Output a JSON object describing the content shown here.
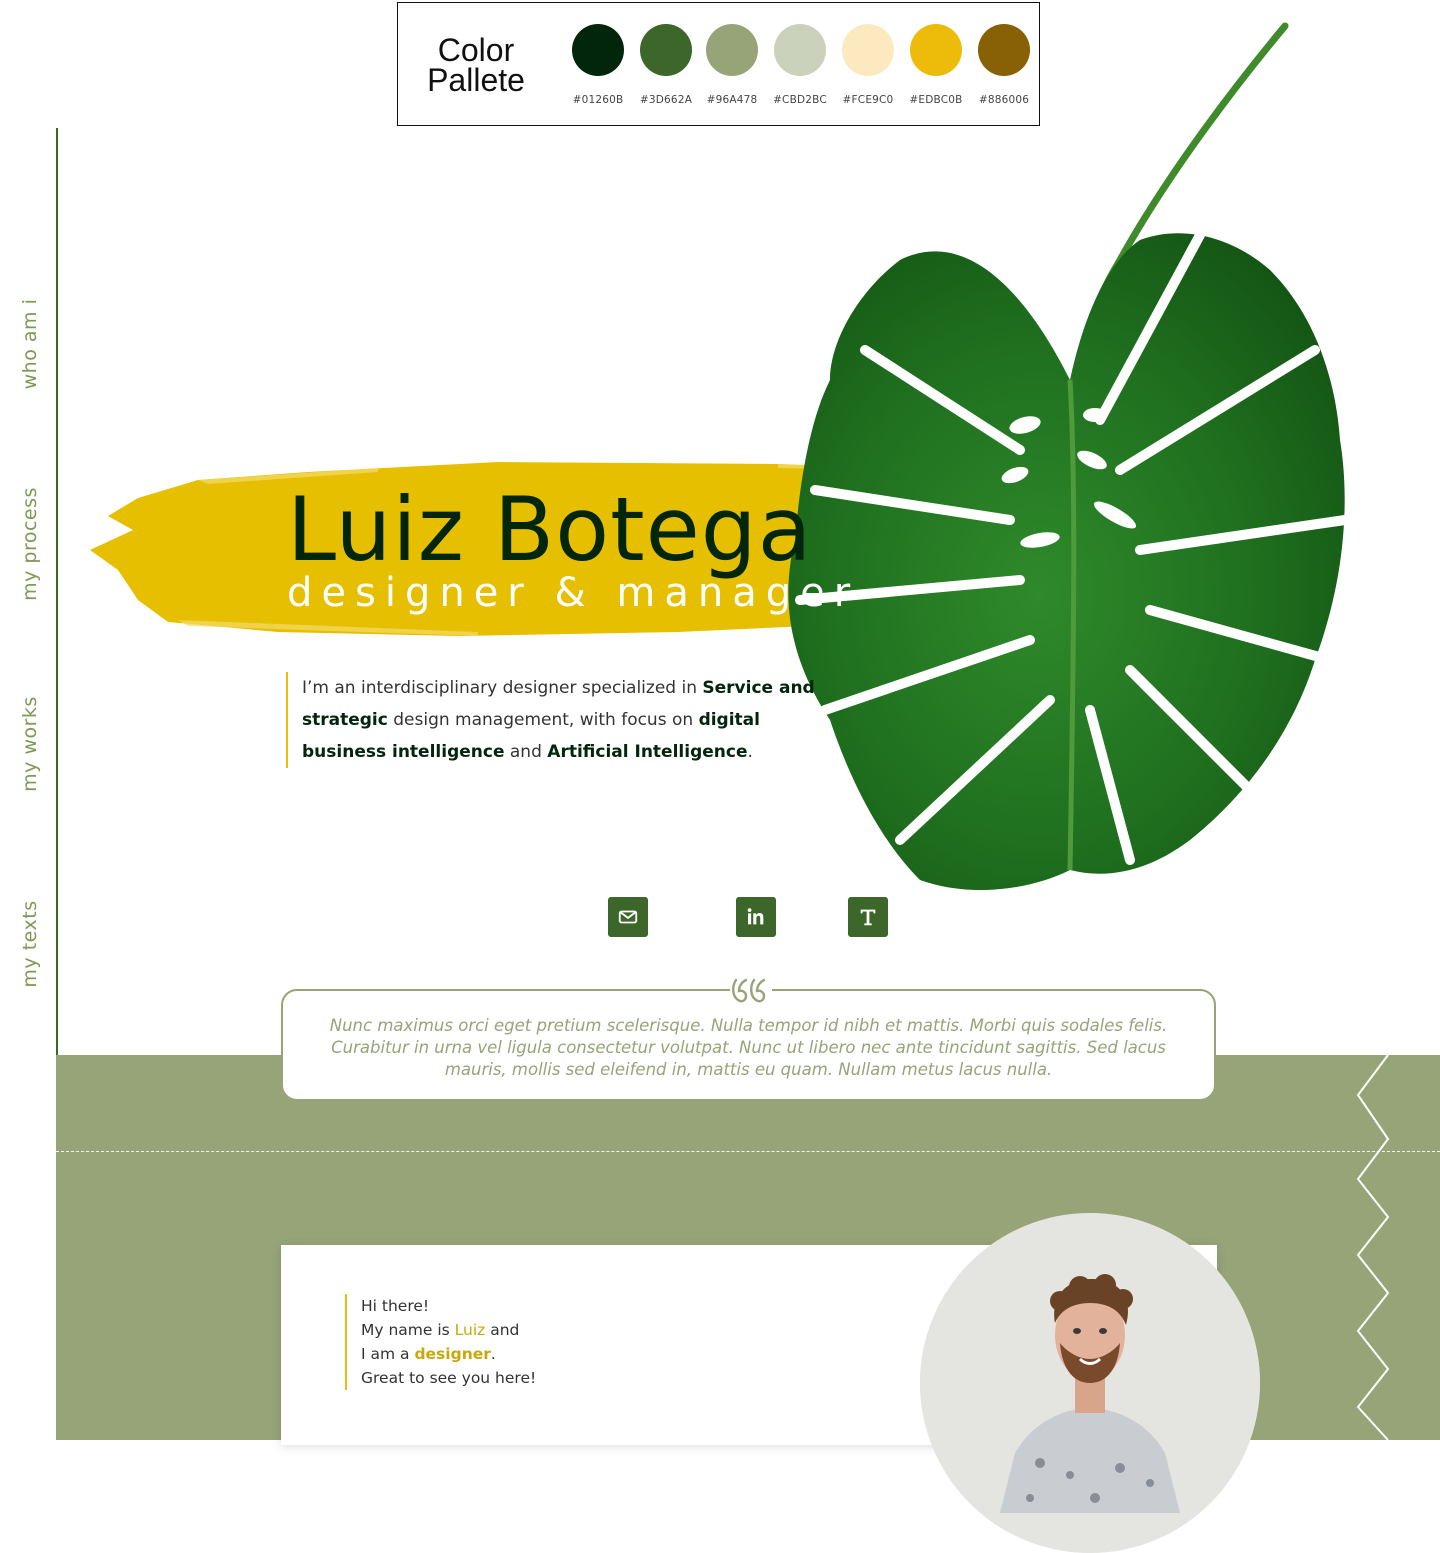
{
  "palette": {
    "title_line1": "Color",
    "title_line2": "Pallete",
    "swatches": [
      {
        "hex": "#01260B",
        "label": "#01260B"
      },
      {
        "hex": "#3D662A",
        "label": "#3D662A"
      },
      {
        "hex": "#96A478",
        "label": "#96A478"
      },
      {
        "hex": "#CBD2BC",
        "label": "#CBD2BC"
      },
      {
        "hex": "#FCE9C0",
        "label": "#FCE9C0"
      },
      {
        "hex": "#EDBC0B",
        "label": "#EDBC0B"
      },
      {
        "hex": "#886006",
        "label": "#886006"
      }
    ]
  },
  "nav": {
    "who_am_i": "who am i",
    "my_process": "my process",
    "my_works": "my works",
    "my_texts": "my texts"
  },
  "hero": {
    "name": "Luiz Botega",
    "role": "designer & manager"
  },
  "intro": {
    "t1": "I’m an interdisciplinary designer specialized in ",
    "b1": "Service and strategic",
    "t2": " design management, with focus on ",
    "b2": "digital business intelligence",
    "t3": " and ",
    "b3": "Artificial Intelligence",
    "t4": "."
  },
  "social": {
    "email_icon": "mail-icon",
    "linkedin_icon": "linkedin-icon",
    "texts_icon": "text-t-icon"
  },
  "quote": {
    "text": "Nunc maximus orci eget pretium scelerisque. Nulla tempor id nibh et mattis. Morbi quis sodales felis. Curabitur in urna vel ligula consectetur volutpat. Nunc ut libero nec ante tincidunt sagittis. Sed lacus mauris, mollis sed eleifend in, mattis eu quam. Nullam metus lacus nulla."
  },
  "about": {
    "line1": "Hi there!",
    "line2_a": "My name is ",
    "line2_name": "Luiz",
    "line2_b": " and",
    "line3_a": "I am a ",
    "line3_role": "designer",
    "line3_b": ".",
    "line4": "Great to see you here!"
  },
  "colors": {
    "dark_green": "#01260B",
    "green": "#3D662A",
    "sage": "#96A478",
    "yellow": "#EDBC0B"
  }
}
